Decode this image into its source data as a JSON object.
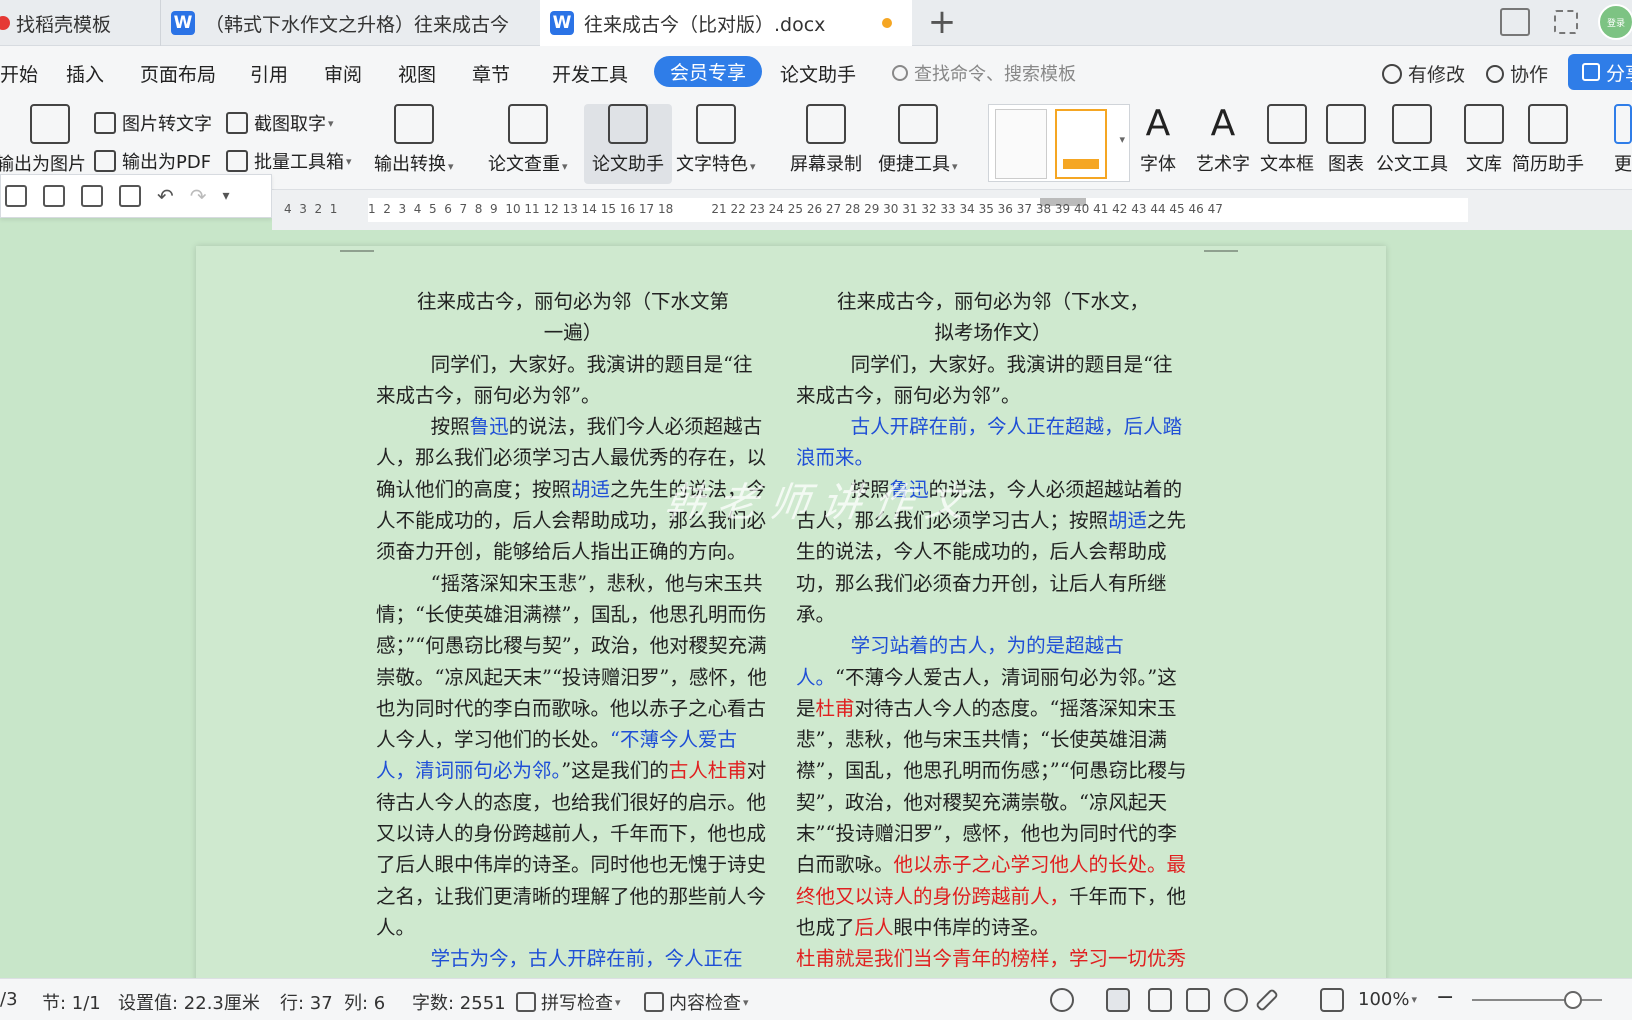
{
  "tabs": [
    {
      "label": "找稻壳模板"
    },
    {
      "label": "（韩式下水作文之升格）往来成古今"
    },
    {
      "label": "往来成古今（比对版）.docx"
    }
  ],
  "avatar_label": "登录",
  "menu": {
    "items": [
      "开始",
      "插入",
      "页面布局",
      "引用",
      "审阅",
      "视图",
      "章节",
      "开发工具",
      "会员专享",
      "论文助手"
    ],
    "active": "会员专享",
    "search_placeholder": "查找命令、搜索模板",
    "has_changes": "有修改",
    "collab": "协作",
    "share": "分享"
  },
  "ribbon": {
    "export_image": "输出为图片",
    "img_to_text": "图片转文字",
    "export_pdf": "输出为PDF",
    "screenshot_text": "截图取字",
    "batch_tools": "批量工具箱",
    "export_convert": "输出转换",
    "paper_check": "论文查重",
    "paper_assistant": "论文助手",
    "text_feature": "文字特色",
    "screen_record": "屏幕录制",
    "quick_tools": "便捷工具",
    "font": "字体",
    "art_text": "艺术字",
    "text_box": "文本框",
    "chart": "图表",
    "official_tools": "公文工具",
    "library": "文库",
    "resume": "简历助手",
    "more": "更"
  },
  "ruler": {
    "numbers": "4  3  2  1        1  2  3  4  5  6  7  8  9  10 11 12 13 14 15 16 17 18          21 22 23 24 25 26 27 28 29 30 31 32 33 34 35 36 37 38 39 40 41 42 43 44 45 46 47"
  },
  "document": {
    "watermark": "韩老师讲作文",
    "left": {
      "title1": "往来成古今，丽句必为邻（下水文第",
      "title2": "一遍）",
      "p1": "同学们，大家好。我演讲的题目是“往来成古今，丽句必为邻”。",
      "p2a": "按照",
      "p2_luxun": "鲁迅",
      "p2b": "的说法，我们今人必须超越古人，那么我们必须学习古人最优秀的存在，以确认他们的高度；按照",
      "p2_hushi": "胡适",
      "p2c": "之先生的说法，今人不能成功的，后人会帮助成功，那么我们必须奋力开创，能够给后人指出正确的方向。",
      "p3a": "“摇落深知宋玉悲”，悲秋，他与宋玉共情；“长使英雄泪满襟”，国乱，他思孔明而伤感；”“何愚窃比稷与契”，政治，他对稷契充满崇敬。“凉风起天末”“投诗赠汨罗”，感怀，他也为同时代的李白而歌咏。他以赤子之心看古人今人，学习他们的长处。",
      "p3_blue": "“不薄今人爱古人，清词丽句必为邻。",
      "p3b": "”这是我们的",
      "p3_red": "古人杜甫",
      "p3c": "对待古人今人的态度，也给我们很好的启示。他又以诗人的身份跨越前人，千年而下，他也成了后人眼中伟岸的诗圣。同时他也无愧于诗史之名，让我们更清晰的理解了他的那些前人今人。",
      "p4_blue": "学古为今，古人开辟在前，今人正在"
    },
    "right": {
      "title1": "往来成古今，丽句必为邻（下水文，",
      "title2": "拟考场作文）",
      "p1": "同学们，大家好。我演讲的题目是“往来成古今，丽句必为邻”。",
      "p2_blue": "古人开辟在前，今人正在超越，后人踏浪而来。",
      "p3a": "按照",
      "p3_luxun": "鲁迅",
      "p3b": "的说法，今人必须超越站着的古人，那么我们必须学习古人；按照",
      "p3_hushi": "胡适",
      "p3c": "之先生的说法，今人不能成功的，后人会帮助成功，那么我们必须奋力开创，让后人有所继承。",
      "p4_blue": "学习站着的古人，为的是超越古人。",
      "p4a": "“不薄今人爱古人，清词丽句必为邻。”这是",
      "p4_red1": "杜甫",
      "p4b": "对待古人今人的态度。“摇落深知宋玉悲”，悲秋，他与宋玉共情；“长使英雄泪满襟”，国乱，他思孔明而伤感；”“何愚窃比稷与契”，政治，他对稷契充满崇敬。“凉风起天末”“投诗赠汨罗”，感怀，他也为同时代的李白而歌咏。",
      "p4_red2": "他以赤子之心学习他人的长处。最终他又以诗人的身份跨越前人，",
      "p4c": "千年而下，他也成了",
      "p4_red3": "后人",
      "p4d": "眼中伟岸的诗圣。",
      "p5_red": "杜甫就是我们当今青年的榜样，学习一切优秀文化，不问国界，不问古今"
    }
  },
  "status": {
    "page": "/3",
    "section": "节: 1/1",
    "setting": "设置值: 22.3厘米",
    "row": "行: 37",
    "col": "列: 6",
    "wordcount": "字数: 2551",
    "spellcheck": "拼写检查",
    "content_check": "内容检查",
    "zoom": "100%"
  },
  "colors": {
    "accent": "#2f7de8",
    "doc_bg": "#c8e6c9",
    "blue_text": "#1f4fd6",
    "red_text": "#e02020",
    "unsaved": "#f5a623"
  }
}
